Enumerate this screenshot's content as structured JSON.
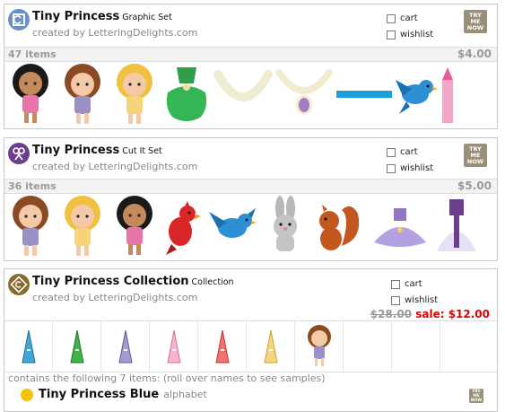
{
  "products": [
    {
      "name": "Tiny Princess",
      "type": "Graphic Set",
      "creator": "created by LetteringDelights.com",
      "cart_label": "cart",
      "wishlist_label": "wishlist",
      "try_label": "TRY ME NOW",
      "items_count": "47 items",
      "price": "$4.00",
      "logo_color": "#6a8fc9",
      "logo_icon": "graphic-set-icon",
      "thumbnails": [
        "girl-dark-hair",
        "girl-brown-hair",
        "girl-blonde-hair",
        "green-dress",
        "pearl-necklace",
        "pendant-necklace",
        "blue-ribbon",
        "bluebird",
        "pink-castle"
      ]
    },
    {
      "name": "Tiny Princess",
      "type": "Cut It Set",
      "creator": "created by LetteringDelights.com",
      "cart_label": "cart",
      "wishlist_label": "wishlist",
      "try_label": "TRY ME NOW",
      "items_count": "36 items",
      "price": "$5.00",
      "logo_color": "#6b3f8e",
      "logo_icon": "scissors-icon",
      "thumbnails": [
        "girl-brown-hair",
        "girl-blonde-hair",
        "girl-dark-hair",
        "cardinal-bird",
        "bluebird",
        "grey-bunny",
        "squirrel",
        "lavender-dress",
        "purple-gown"
      ]
    },
    {
      "name": "Tiny Princess Collection",
      "type": "Collection",
      "creator": "created by LetteringDelights.com",
      "cart_label": "cart",
      "wishlist_label": "wishlist",
      "old_price": "$28.00",
      "sale_price": "sale: $12.00",
      "logo_color": "#8a6a2c",
      "logo_icon": "collection-icon",
      "grid_items": [
        "blue-letter-a",
        "green-letter-a",
        "purple-letter-a",
        "pink-letter-a",
        "red-letter-a",
        "yellow-letter-a",
        "girl-brown-hair"
      ],
      "contains_text": "contains the following 7 items: (roll over names to see samples)",
      "sub_item": {
        "name": "Tiny Princess Blue",
        "type": "alphabet",
        "try_label": "TRY ME NOW"
      }
    }
  ],
  "colors": {
    "sale": "#dd0000",
    "muted": "#999999"
  }
}
